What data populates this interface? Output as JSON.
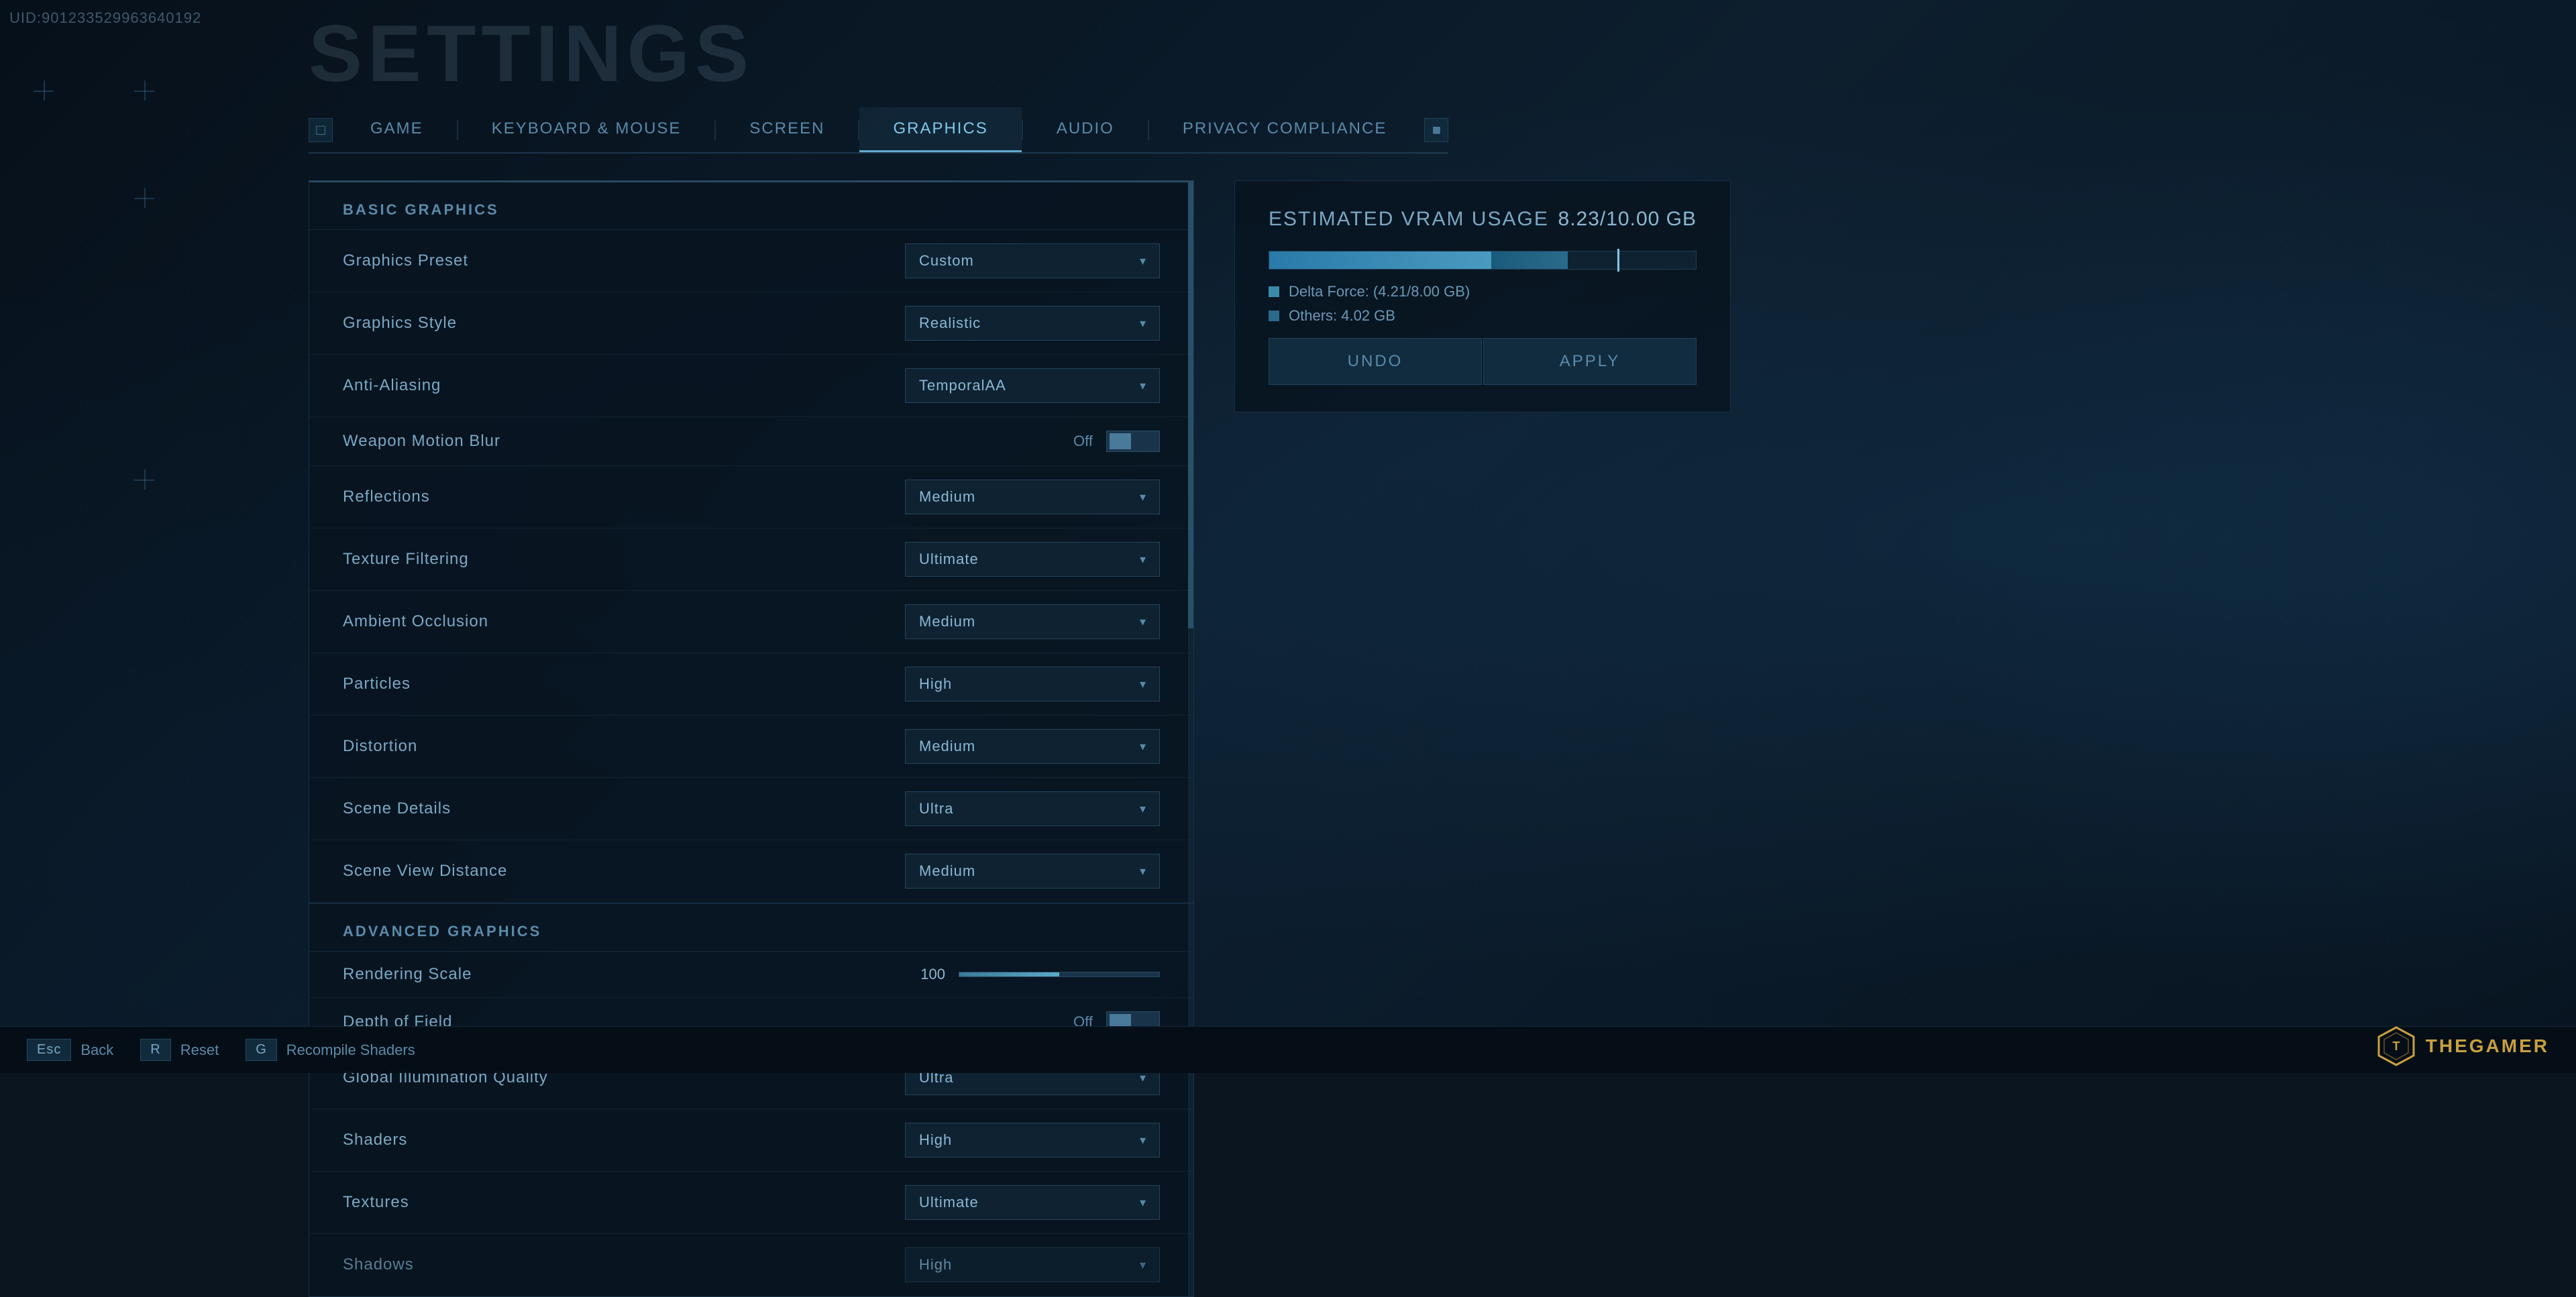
{
  "uid": "UID:901233529963640192",
  "page_title": "Settings",
  "nav": {
    "left_bracket": "□",
    "right_bracket": "■",
    "tabs": [
      {
        "id": "game",
        "label": "GAME",
        "active": false
      },
      {
        "id": "keyboard-mouse",
        "label": "KEYBOARD & MOUSE",
        "active": false
      },
      {
        "id": "screen",
        "label": "SCREEN",
        "active": false
      },
      {
        "id": "graphics",
        "label": "GRAPHICS",
        "active": true
      },
      {
        "id": "audio",
        "label": "AUDIO",
        "active": false
      },
      {
        "id": "privacy-compliance",
        "label": "PRIVACY COMPLIANCE",
        "active": false
      }
    ]
  },
  "basic_graphics": {
    "section_label": "BASIC GRAPHICS",
    "settings": [
      {
        "id": "graphics-preset",
        "label": "Graphics Preset",
        "type": "dropdown",
        "value": "Custom"
      },
      {
        "id": "graphics-style",
        "label": "Graphics Style",
        "type": "dropdown",
        "value": "Realistic"
      },
      {
        "id": "anti-aliasing",
        "label": "Anti-Aliasing",
        "type": "dropdown",
        "value": "TemporalAA"
      },
      {
        "id": "weapon-motion-blur",
        "label": "Weapon Motion Blur",
        "type": "toggle",
        "value": "Off"
      },
      {
        "id": "reflections",
        "label": "Reflections",
        "type": "dropdown",
        "value": "Medium"
      },
      {
        "id": "texture-filtering",
        "label": "Texture Filtering",
        "type": "dropdown",
        "value": "Ultimate"
      },
      {
        "id": "ambient-occlusion",
        "label": "Ambient Occlusion",
        "type": "dropdown",
        "value": "Medium"
      },
      {
        "id": "particles",
        "label": "Particles",
        "type": "dropdown",
        "value": "High"
      },
      {
        "id": "distortion",
        "label": "Distortion",
        "type": "dropdown",
        "value": "Medium"
      },
      {
        "id": "scene-details",
        "label": "Scene Details",
        "type": "dropdown",
        "value": "Ultra"
      },
      {
        "id": "scene-view-distance",
        "label": "Scene View Distance",
        "type": "dropdown",
        "value": "Medium"
      }
    ]
  },
  "advanced_graphics": {
    "section_label": "ADVANCED GRAPHICS",
    "settings": [
      {
        "id": "rendering-scale",
        "label": "Rendering Scale",
        "type": "slider",
        "value": "100",
        "percent": 50
      },
      {
        "id": "depth-of-field",
        "label": "Depth of Field",
        "type": "toggle",
        "value": "Off"
      },
      {
        "id": "global-illumination-quality",
        "label": "Global Illumination Quality",
        "type": "dropdown",
        "value": "Ultra"
      },
      {
        "id": "shaders",
        "label": "Shaders",
        "type": "dropdown",
        "value": "High"
      },
      {
        "id": "textures",
        "label": "Textures",
        "type": "dropdown",
        "value": "Ultimate"
      },
      {
        "id": "shadows",
        "label": "Shadows",
        "type": "dropdown",
        "value": "High"
      }
    ]
  },
  "vram": {
    "title": "Estimated VRAM Usage",
    "value": "8.23/10.00 GB",
    "delta_force_label": "Delta Force: (4.21/8.00 GB)",
    "others_label": "Others: 4.02 GB",
    "delta_width_percent": 52,
    "others_width_percent": 18,
    "marker_right_percent": 18
  },
  "actions": {
    "undo_label": "UNDO",
    "apply_label": "APPLY"
  },
  "bottom_bar": {
    "keys": [
      {
        "key": "Esc",
        "label": "Back"
      },
      {
        "key": "R",
        "label": "Reset"
      },
      {
        "key": "G",
        "label": "Recompile Shaders"
      }
    ]
  },
  "logo": {
    "text": "THEGAMER"
  }
}
